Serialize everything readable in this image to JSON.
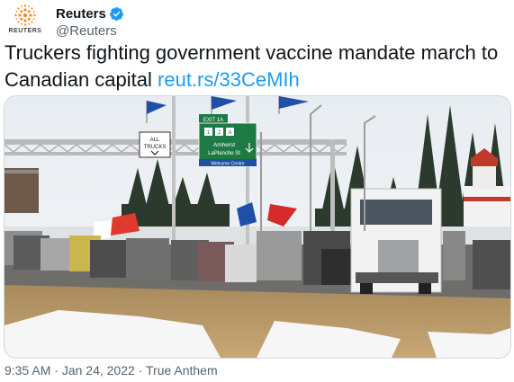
{
  "author": {
    "display_name": "Reuters",
    "handle": "@Reuters",
    "avatar_label": "REUTERS",
    "verified_icon": "verified-badge-icon",
    "verified_color": "#1d9bf0"
  },
  "tweet": {
    "text": "Truckers fighting government vaccine mandate march to Canadian capital ",
    "link_text": "reut.rs/33CeMIh",
    "link_color": "#1d9bf0"
  },
  "media": {
    "signs": {
      "all_trucks_line1": "ALL",
      "all_trucks_line2": "TRUCKS",
      "exit": "EXIT 1A",
      "route_numbers": [
        "1",
        "2",
        "A"
      ],
      "destination1": "Amherst",
      "destination2": "LaPlanche St",
      "welcome": "Welcome Centre"
    }
  },
  "meta": {
    "time": "9:35 AM",
    "separator": "·",
    "date": "Jan 24, 2022",
    "source": "True Anthem"
  }
}
